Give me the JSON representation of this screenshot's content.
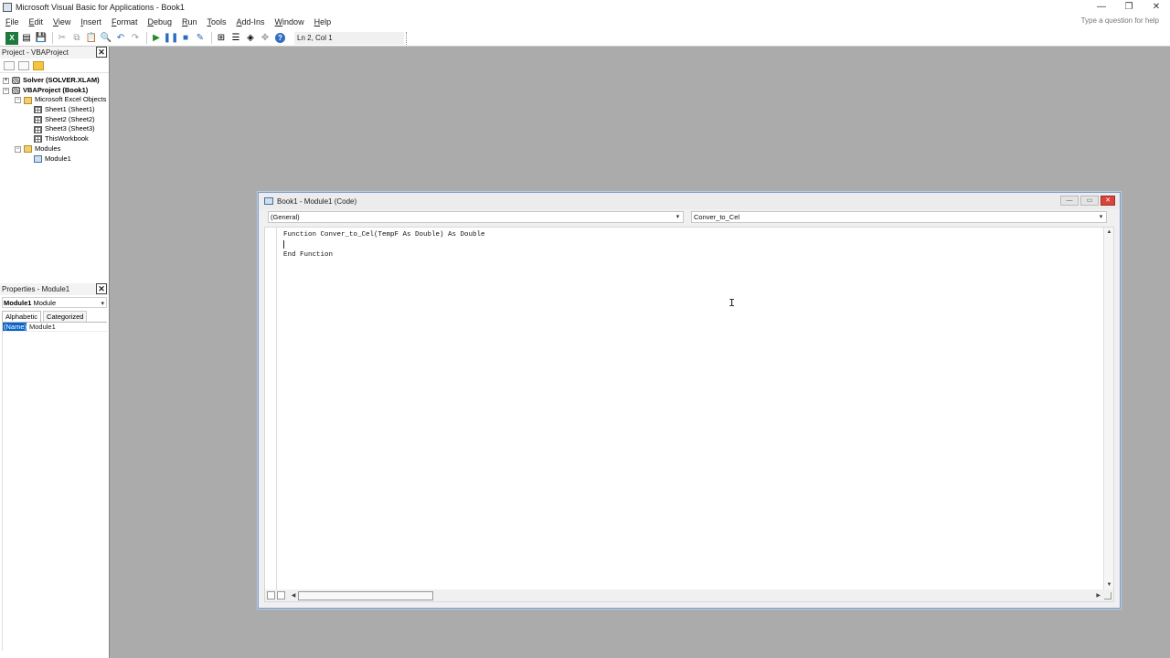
{
  "window": {
    "title": "Microsoft Visual Basic for Applications - Book1",
    "buttons": [
      "—",
      "❐",
      "✕"
    ]
  },
  "menu": {
    "items": [
      {
        "first": "F",
        "rest": "ile"
      },
      {
        "first": "E",
        "rest": "dit"
      },
      {
        "first": "V",
        "rest": "iew"
      },
      {
        "first": "I",
        "rest": "nsert"
      },
      {
        "first": "F",
        "rest": "ormat"
      },
      {
        "first": "D",
        "rest": "ebug"
      },
      {
        "first": "R",
        "rest": "un"
      },
      {
        "first": "T",
        "rest": "ools"
      },
      {
        "first": "A",
        "rest": "dd-Ins"
      },
      {
        "first": "W",
        "rest": "indow"
      },
      {
        "first": "H",
        "rest": "elp"
      }
    ],
    "help_placeholder": "Type a question for help"
  },
  "toolbar": {
    "status": "Ln 2, Col 1"
  },
  "project_pane": {
    "title": "Project - VBAProject",
    "tree": [
      {
        "label": "Solver (SOLVER.XLAM)",
        "level": 0,
        "bold": true,
        "icon": "vba-project-icon",
        "expander": "+"
      },
      {
        "label": "VBAProject (Book1)",
        "level": 0,
        "bold": true,
        "icon": "vba-project-icon",
        "expander": "−"
      },
      {
        "label": "Microsoft Excel Objects",
        "level": 1,
        "bold": false,
        "icon": "folder-icon",
        "expander": "−"
      },
      {
        "label": "Sheet1 (Sheet1)",
        "level": 2,
        "bold": false,
        "icon": "sheet-icon",
        "expander": ""
      },
      {
        "label": "Sheet2 (Sheet2)",
        "level": 2,
        "bold": false,
        "icon": "sheet-icon",
        "expander": ""
      },
      {
        "label": "Sheet3 (Sheet3)",
        "level": 2,
        "bold": false,
        "icon": "sheet-icon",
        "expander": ""
      },
      {
        "label": "ThisWorkbook",
        "level": 2,
        "bold": false,
        "icon": "sheet-icon",
        "expander": ""
      },
      {
        "label": "Modules",
        "level": 1,
        "bold": false,
        "icon": "folder-icon",
        "expander": "−"
      },
      {
        "label": "Module1",
        "level": 2,
        "bold": false,
        "icon": "module-icon",
        "expander": ""
      }
    ]
  },
  "properties_pane": {
    "title": "Properties - Module1",
    "object_name": "Module1",
    "object_type": "Module",
    "tabs": [
      "Alphabetic",
      "Categorized"
    ],
    "rows": [
      {
        "key": "(Name)",
        "value": "Module1"
      }
    ]
  },
  "code_window": {
    "title": "Book1 - Module1 (Code)",
    "object_combo": "(General)",
    "procedure_combo": "Conver_to_Cel",
    "lines": [
      "Function Conver_to_Cel(TempF As Double) As Double",
      "",
      "End Function"
    ]
  }
}
